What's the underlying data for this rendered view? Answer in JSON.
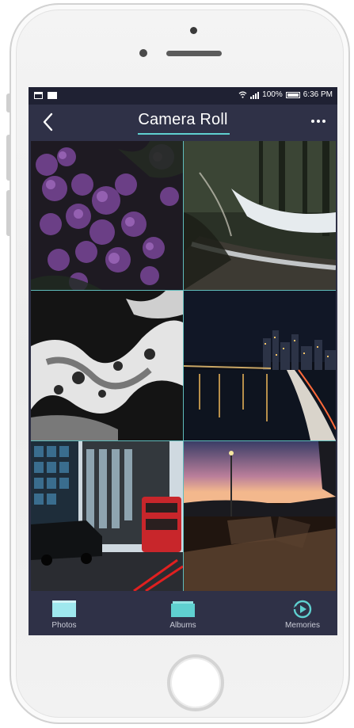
{
  "status_bar": {
    "battery": "100%",
    "time": "6:36 PM",
    "icons": [
      "calendar-icon",
      "mail-icon",
      "wifi-icon",
      "signal-icon",
      "battery-icon"
    ]
  },
  "nav": {
    "title": "Camera Roll",
    "back_icon": "chevron-left-icon",
    "more_icon": "more-dots-icon"
  },
  "photos": [
    {
      "subject": "purple hydrangea flowers"
    },
    {
      "subject": "snowy forest path"
    },
    {
      "subject": "black and white ocean waves"
    },
    {
      "subject": "city skyline at night over water"
    },
    {
      "subject": "london street with red bus and taxi"
    },
    {
      "subject": "benches at sunset"
    }
  ],
  "tabs": [
    {
      "label": "Photos",
      "icon": "photos-icon"
    },
    {
      "label": "Albums",
      "icon": "albums-icon"
    },
    {
      "label": "Memories",
      "icon": "memories-icon"
    }
  ],
  "colors": {
    "screen_bg": "#2f3147",
    "accent": "#5fd0d0",
    "status_bg": "#1f2133"
  }
}
